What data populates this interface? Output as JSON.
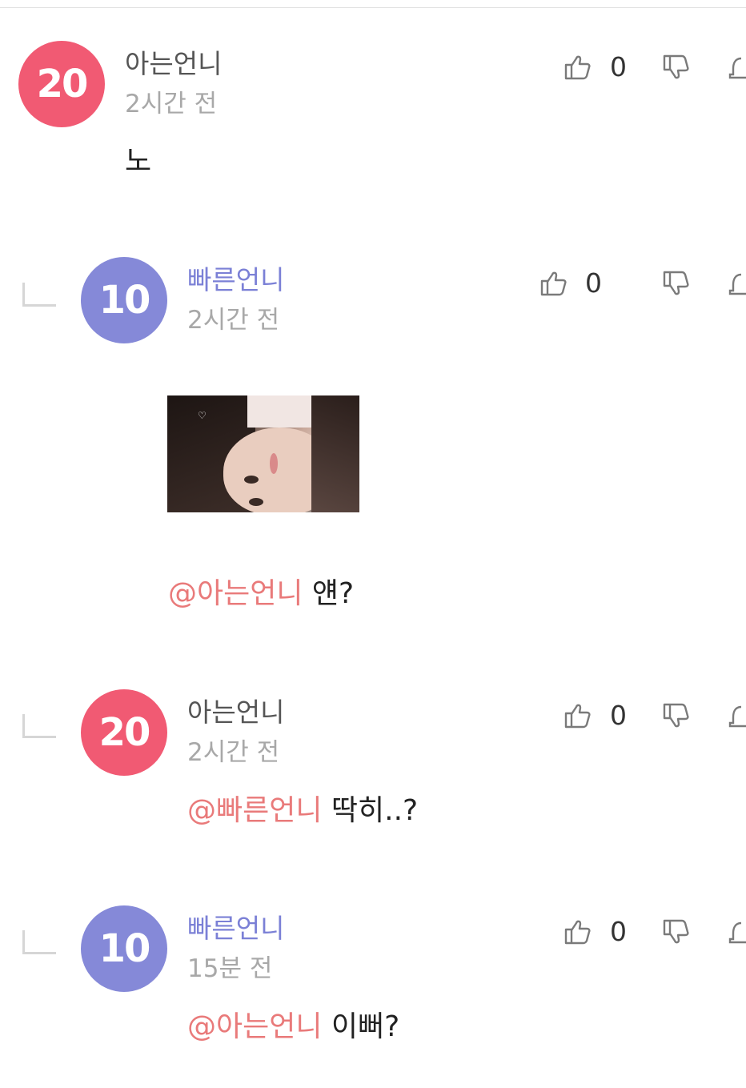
{
  "comments": [
    {
      "author": "아는언니",
      "level": "20",
      "time": "2시간 전",
      "mention": "",
      "text": "노",
      "likes": "0",
      "is_reply": false,
      "avatar_color": "#f15a73",
      "author_color": "#555555"
    },
    {
      "author": "빠른언니",
      "level": "10",
      "time": "2시간 전",
      "mention": "@아는언니",
      "text": " 얜?",
      "likes": "0",
      "is_reply": true,
      "avatar_color": "#8589d8",
      "author_color": "#7b80d6",
      "has_image": true
    },
    {
      "author": "아는언니",
      "level": "20",
      "time": "2시간 전",
      "mention": "@빠른언니",
      "text": " 딱히..?",
      "likes": "0",
      "is_reply": true,
      "avatar_color": "#f15a73",
      "author_color": "#555555"
    },
    {
      "author": "빠른언니",
      "level": "10",
      "time": "15분 전",
      "mention": "@아는언니",
      "text": " 이뻐?",
      "likes": "0",
      "is_reply": true,
      "avatar_color": "#8589d8",
      "author_color": "#7b80d6"
    }
  ],
  "icons": {
    "like": "thumbs-up-icon",
    "dislike": "thumbs-down-icon",
    "report": "bell-icon"
  }
}
